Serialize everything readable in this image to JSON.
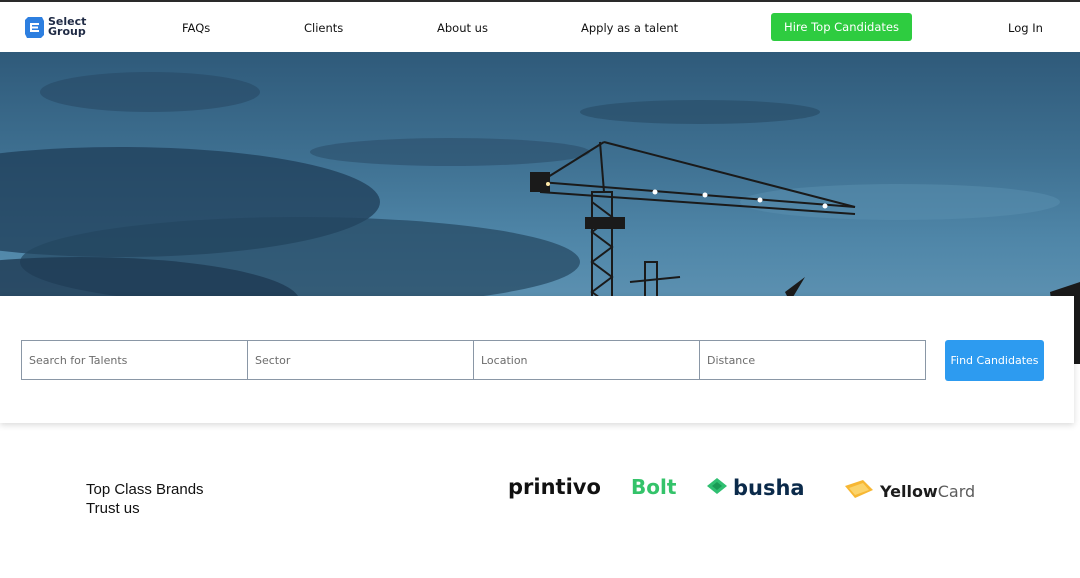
{
  "header": {
    "logo_main": "Select",
    "logo_sub": "Group",
    "nav": [
      "FAQs",
      "Clients",
      "About us",
      "Apply as a talent"
    ],
    "hire_button": "Hire Top Candidates",
    "login": "Log In"
  },
  "search": {
    "talents_placeholder": "Search for Talents",
    "sector_placeholder": "Sector",
    "location_placeholder": "Location",
    "distance_placeholder": "Distance",
    "find_button": "Find Candidates"
  },
  "brands": {
    "heading_line1": "Top Class Brands",
    "heading_line2": "Trust us",
    "printivo": "printivo",
    "bolt": "Bolt",
    "busha": "busha",
    "yellowcard_strong": "Yellow",
    "yellowcard_light": "Card"
  },
  "colors": {
    "hire_button": "#2ecc40",
    "find_button": "#2d9bf0",
    "bolt": "#34c36a",
    "busha": "#0b2a4a",
    "yellowcard_icon": "#f7b733"
  },
  "icons": {
    "logo": "e-logo-icon",
    "busha": "busha-leaf-icon",
    "yellowcard": "yellowcard-icon"
  }
}
